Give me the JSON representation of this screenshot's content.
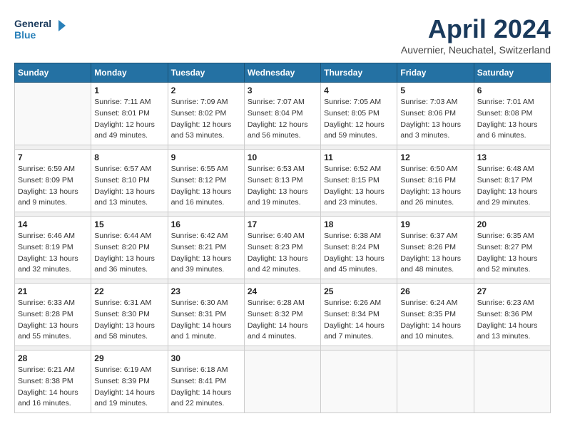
{
  "logo": {
    "line1": "General",
    "line2": "Blue"
  },
  "title": "April 2024",
  "location": "Auvernier, Neuchatel, Switzerland",
  "days_header": [
    "Sunday",
    "Monday",
    "Tuesday",
    "Wednesday",
    "Thursday",
    "Friday",
    "Saturday"
  ],
  "weeks": [
    [
      {
        "day": "",
        "info": ""
      },
      {
        "day": "1",
        "info": "Sunrise: 7:11 AM\nSunset: 8:01 PM\nDaylight: 12 hours\nand 49 minutes."
      },
      {
        "day": "2",
        "info": "Sunrise: 7:09 AM\nSunset: 8:02 PM\nDaylight: 12 hours\nand 53 minutes."
      },
      {
        "day": "3",
        "info": "Sunrise: 7:07 AM\nSunset: 8:04 PM\nDaylight: 12 hours\nand 56 minutes."
      },
      {
        "day": "4",
        "info": "Sunrise: 7:05 AM\nSunset: 8:05 PM\nDaylight: 12 hours\nand 59 minutes."
      },
      {
        "day": "5",
        "info": "Sunrise: 7:03 AM\nSunset: 8:06 PM\nDaylight: 13 hours\nand 3 minutes."
      },
      {
        "day": "6",
        "info": "Sunrise: 7:01 AM\nSunset: 8:08 PM\nDaylight: 13 hours\nand 6 minutes."
      }
    ],
    [
      {
        "day": "7",
        "info": "Sunrise: 6:59 AM\nSunset: 8:09 PM\nDaylight: 13 hours\nand 9 minutes."
      },
      {
        "day": "8",
        "info": "Sunrise: 6:57 AM\nSunset: 8:10 PM\nDaylight: 13 hours\nand 13 minutes."
      },
      {
        "day": "9",
        "info": "Sunrise: 6:55 AM\nSunset: 8:12 PM\nDaylight: 13 hours\nand 16 minutes."
      },
      {
        "day": "10",
        "info": "Sunrise: 6:53 AM\nSunset: 8:13 PM\nDaylight: 13 hours\nand 19 minutes."
      },
      {
        "day": "11",
        "info": "Sunrise: 6:52 AM\nSunset: 8:15 PM\nDaylight: 13 hours\nand 23 minutes."
      },
      {
        "day": "12",
        "info": "Sunrise: 6:50 AM\nSunset: 8:16 PM\nDaylight: 13 hours\nand 26 minutes."
      },
      {
        "day": "13",
        "info": "Sunrise: 6:48 AM\nSunset: 8:17 PM\nDaylight: 13 hours\nand 29 minutes."
      }
    ],
    [
      {
        "day": "14",
        "info": "Sunrise: 6:46 AM\nSunset: 8:19 PM\nDaylight: 13 hours\nand 32 minutes."
      },
      {
        "day": "15",
        "info": "Sunrise: 6:44 AM\nSunset: 8:20 PM\nDaylight: 13 hours\nand 36 minutes."
      },
      {
        "day": "16",
        "info": "Sunrise: 6:42 AM\nSunset: 8:21 PM\nDaylight: 13 hours\nand 39 minutes."
      },
      {
        "day": "17",
        "info": "Sunrise: 6:40 AM\nSunset: 8:23 PM\nDaylight: 13 hours\nand 42 minutes."
      },
      {
        "day": "18",
        "info": "Sunrise: 6:38 AM\nSunset: 8:24 PM\nDaylight: 13 hours\nand 45 minutes."
      },
      {
        "day": "19",
        "info": "Sunrise: 6:37 AM\nSunset: 8:26 PM\nDaylight: 13 hours\nand 48 minutes."
      },
      {
        "day": "20",
        "info": "Sunrise: 6:35 AM\nSunset: 8:27 PM\nDaylight: 13 hours\nand 52 minutes."
      }
    ],
    [
      {
        "day": "21",
        "info": "Sunrise: 6:33 AM\nSunset: 8:28 PM\nDaylight: 13 hours\nand 55 minutes."
      },
      {
        "day": "22",
        "info": "Sunrise: 6:31 AM\nSunset: 8:30 PM\nDaylight: 13 hours\nand 58 minutes."
      },
      {
        "day": "23",
        "info": "Sunrise: 6:30 AM\nSunset: 8:31 PM\nDaylight: 14 hours\nand 1 minute."
      },
      {
        "day": "24",
        "info": "Sunrise: 6:28 AM\nSunset: 8:32 PM\nDaylight: 14 hours\nand 4 minutes."
      },
      {
        "day": "25",
        "info": "Sunrise: 6:26 AM\nSunset: 8:34 PM\nDaylight: 14 hours\nand 7 minutes."
      },
      {
        "day": "26",
        "info": "Sunrise: 6:24 AM\nSunset: 8:35 PM\nDaylight: 14 hours\nand 10 minutes."
      },
      {
        "day": "27",
        "info": "Sunrise: 6:23 AM\nSunset: 8:36 PM\nDaylight: 14 hours\nand 13 minutes."
      }
    ],
    [
      {
        "day": "28",
        "info": "Sunrise: 6:21 AM\nSunset: 8:38 PM\nDaylight: 14 hours\nand 16 minutes."
      },
      {
        "day": "29",
        "info": "Sunrise: 6:19 AM\nSunset: 8:39 PM\nDaylight: 14 hours\nand 19 minutes."
      },
      {
        "day": "30",
        "info": "Sunrise: 6:18 AM\nSunset: 8:41 PM\nDaylight: 14 hours\nand 22 minutes."
      },
      {
        "day": "",
        "info": ""
      },
      {
        "day": "",
        "info": ""
      },
      {
        "day": "",
        "info": ""
      },
      {
        "day": "",
        "info": ""
      }
    ]
  ]
}
